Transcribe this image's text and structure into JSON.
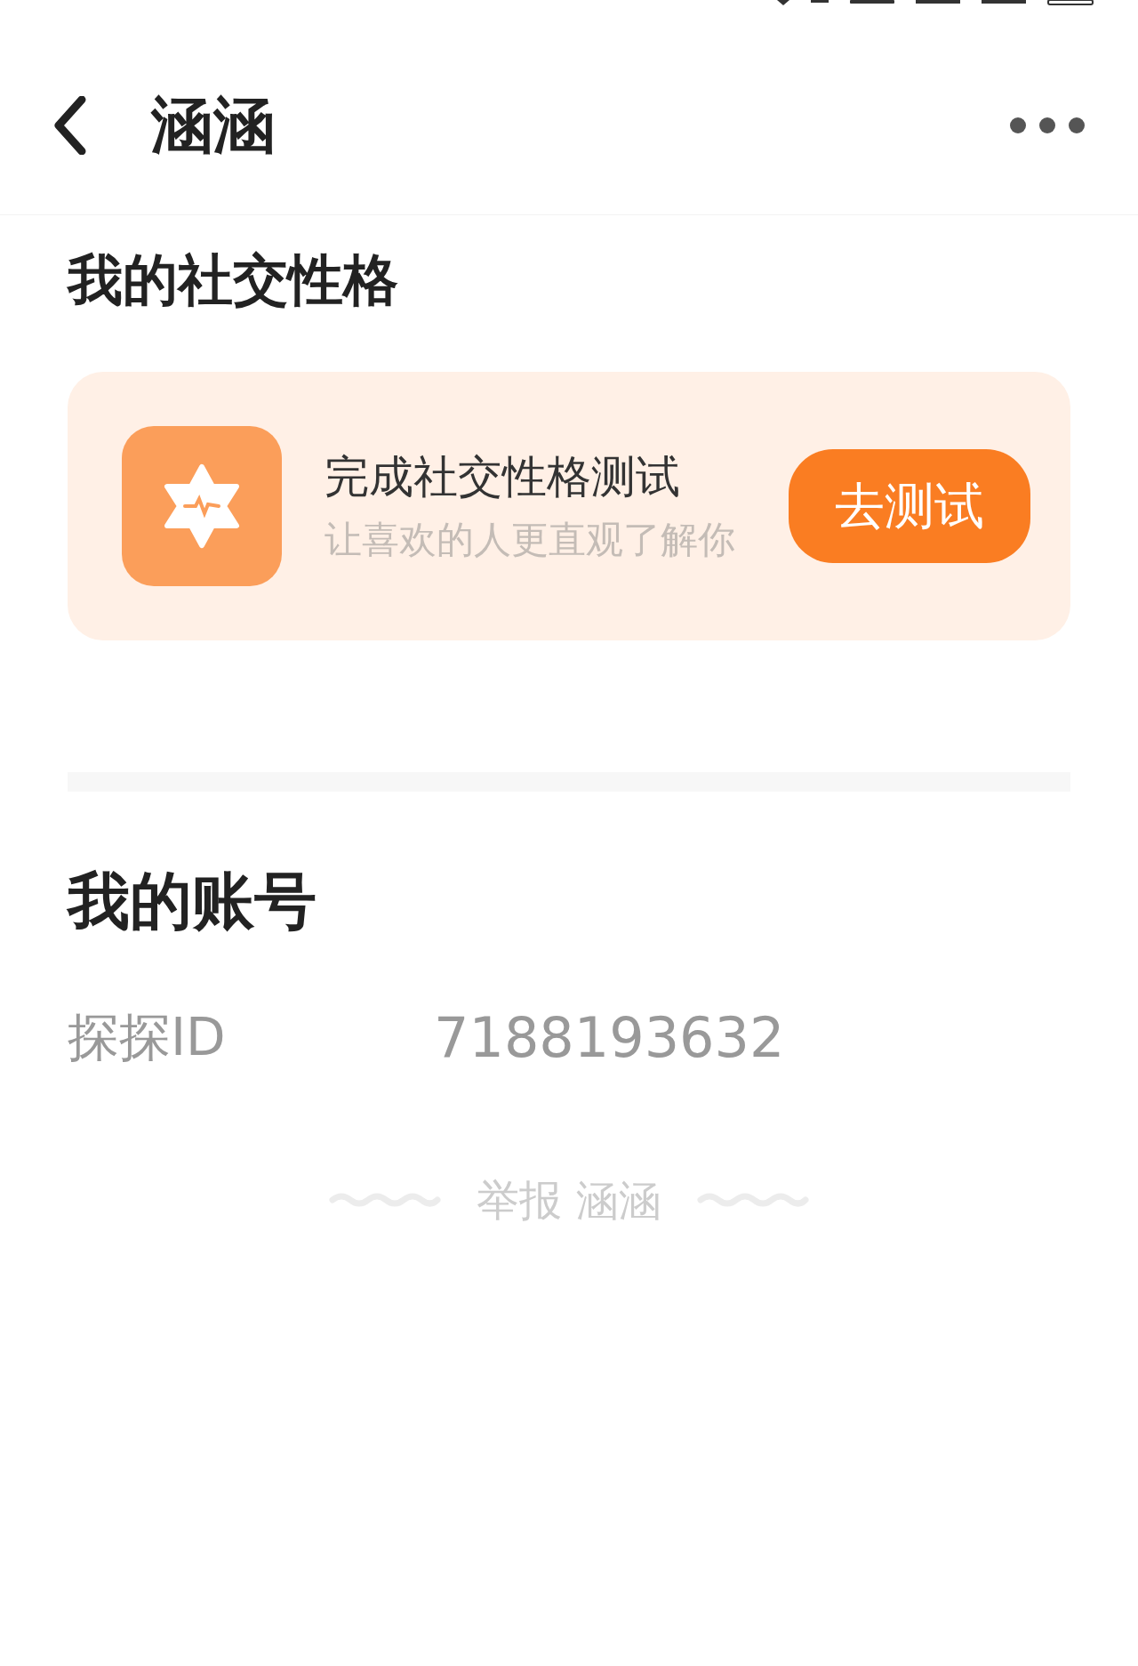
{
  "header": {
    "title": "涵涵"
  },
  "personality": {
    "heading": "我的社交性格",
    "card": {
      "title": "完成社交性格测试",
      "subtitle": "让喜欢的人更直观了解你",
      "button": "去测试"
    }
  },
  "account": {
    "heading": "我的账号",
    "fields": [
      {
        "label": "探探ID",
        "value": "7188193632"
      }
    ]
  },
  "report": {
    "label": "举报 涵涵"
  }
}
